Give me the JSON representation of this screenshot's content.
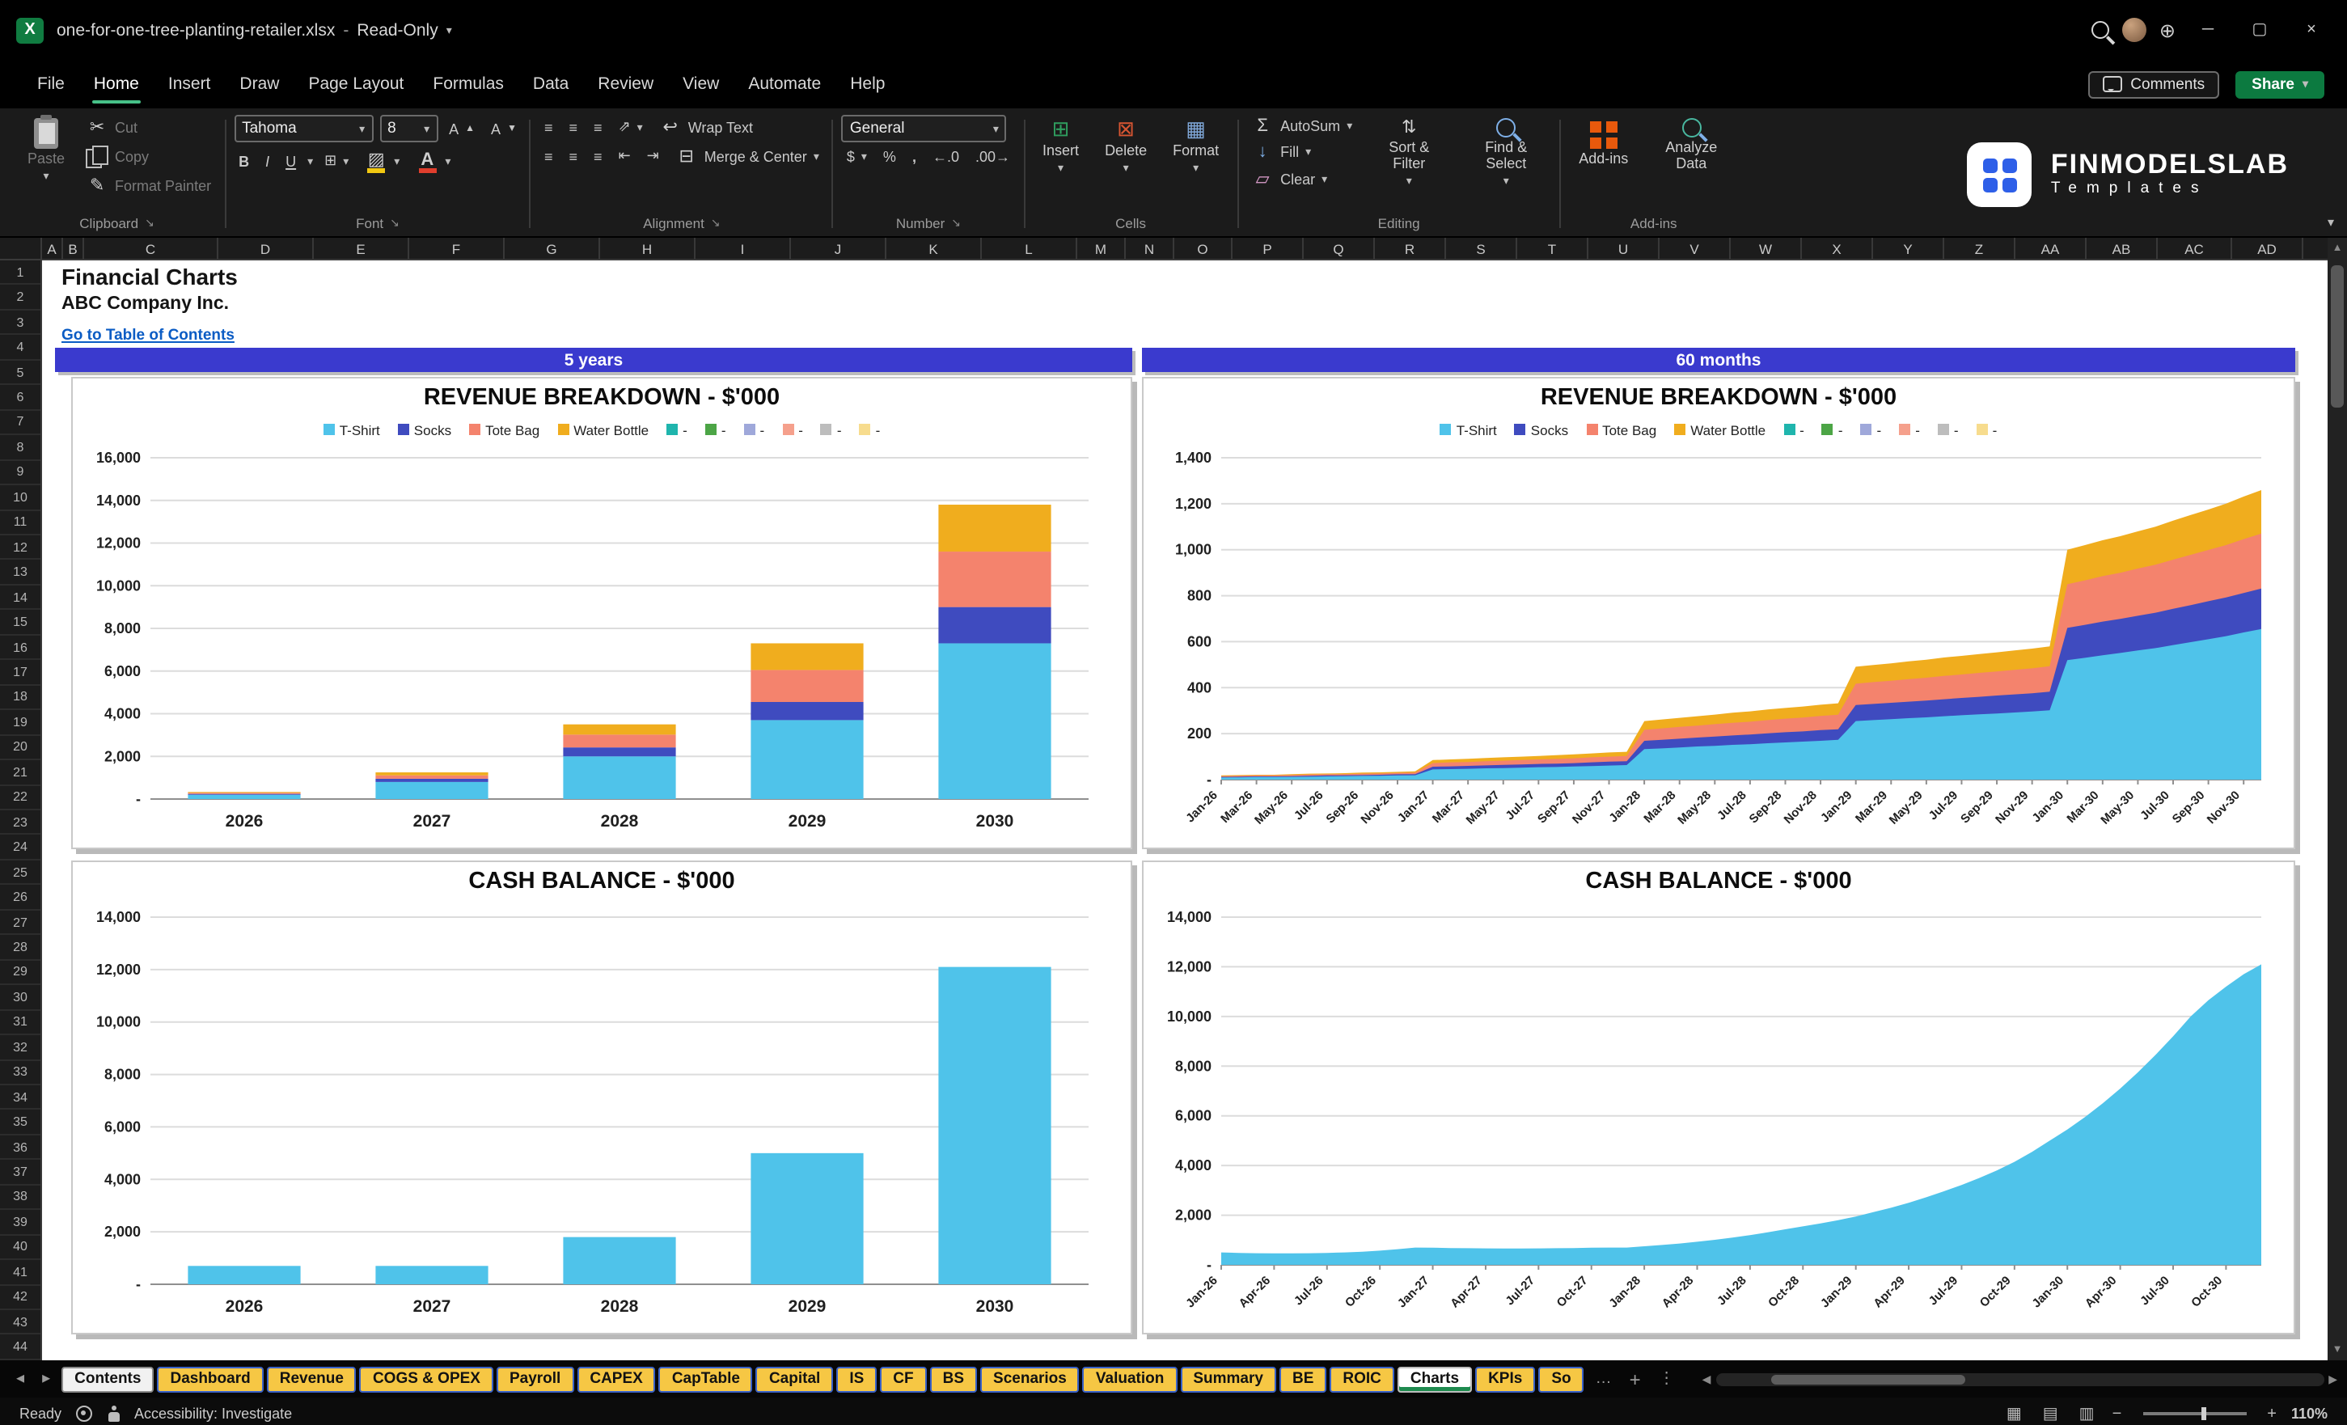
{
  "titlebar": {
    "filename": "one-for-one-tree-planting-retailer.xlsx",
    "separator": "-",
    "mode": "Read-Only"
  },
  "menubar": {
    "items": [
      "File",
      "Home",
      "Insert",
      "Draw",
      "Page Layout",
      "Formulas",
      "Data",
      "Review",
      "View",
      "Automate",
      "Help"
    ],
    "active": "Home",
    "comments": "Comments",
    "share": "Share"
  },
  "ribbon": {
    "clipboard": {
      "label": "Clipboard",
      "paste": "Paste",
      "cut": "Cut",
      "copy": "Copy",
      "format_painter": "Format Painter"
    },
    "font": {
      "label": "Font",
      "family": "Tahoma",
      "size": "8"
    },
    "alignment": {
      "label": "Alignment",
      "wrap": "Wrap Text",
      "merge": "Merge & Center"
    },
    "number": {
      "label": "Number",
      "format": "General"
    },
    "cells": {
      "label": "Cells",
      "insert": "Insert",
      "delete": "Delete",
      "format": "Format"
    },
    "editing": {
      "label": "Editing",
      "autosum": "AutoSum",
      "fill": "Fill",
      "clear": "Clear",
      "sort": "Sort & Filter",
      "find": "Find & Select"
    },
    "addins": {
      "label": "Add-ins",
      "addins": "Add-ins",
      "analyze": "Analyze Data"
    },
    "brand": {
      "name": "FINMODELSLAB",
      "sub": "Templates"
    }
  },
  "sheet": {
    "columns": [
      "A",
      "B",
      "C",
      "D",
      "E",
      "F",
      "G",
      "H",
      "I",
      "J",
      "K",
      "L",
      "M",
      "N",
      "O",
      "P",
      "Q",
      "R",
      "S",
      "T",
      "U",
      "V",
      "W",
      "X",
      "Y",
      "Z",
      "AA",
      "AB",
      "AC",
      "AD"
    ],
    "row_count": 44,
    "title": "Financial Charts",
    "company": "ABC Company Inc.",
    "link": "Go to Table of Contents",
    "banner_left": "5 years",
    "banner_right": "60 months"
  },
  "chart_data": [
    {
      "type": "stacked-bar",
      "title": "REVENUE BREAKDOWN - $'000",
      "categories": [
        "2026",
        "2027",
        "2028",
        "2029",
        "2030"
      ],
      "series": [
        {
          "name": "T-Shirt",
          "color": "#4FC3EA",
          "values": [
            200,
            800,
            2000,
            3700,
            7300
          ]
        },
        {
          "name": "Socks",
          "color": "#3F4BBF",
          "values": [
            40,
            150,
            420,
            850,
            1700
          ]
        },
        {
          "name": "Tote Bag",
          "color": "#F4836D",
          "values": [
            50,
            160,
            600,
            1500,
            2600
          ]
        },
        {
          "name": "Water Bottle",
          "color": "#F0AD1E",
          "values": [
            40,
            140,
            480,
            1250,
            2200
          ]
        }
      ],
      "legend_extra": [
        {
          "label": "-",
          "color": "#1FB5AD"
        },
        {
          "label": "-",
          "color": "#4CA546"
        },
        {
          "label": "-",
          "color": "#9FA8DA"
        },
        {
          "label": "-",
          "color": "#F5A08C"
        },
        {
          "label": "-",
          "color": "#BDBDBD"
        },
        {
          "label": "-",
          "color": "#F7DC8E"
        }
      ],
      "ymax": 16000,
      "ytick_labels": [
        "-",
        "2,000",
        "4,000",
        "6,000",
        "8,000",
        "10,000",
        "12,000",
        "14,000",
        "16,000"
      ]
    },
    {
      "type": "stacked-area",
      "title": "REVENUE BREAKDOWN - $'000",
      "x_labels": [
        "Jan-26",
        "Mar-26",
        "May-26",
        "Jul-26",
        "Sep-26",
        "Nov-26",
        "Jan-27",
        "Mar-27",
        "May-27",
        "Jul-27",
        "Sep-27",
        "Nov-27",
        "Jan-28",
        "Mar-28",
        "May-28",
        "Jul-28",
        "Sep-28",
        "Nov-28",
        "Jan-29",
        "Mar-29",
        "May-29",
        "Jul-29",
        "Sep-29",
        "Nov-29",
        "Jan-30",
        "Mar-30",
        "May-30",
        "Jul-30",
        "Sep-30",
        "Nov-30"
      ],
      "label_step": 2,
      "series": [
        {
          "name": "T-Shirt",
          "color": "#4FC3EA",
          "values": [
            9,
            10,
            11,
            11,
            12,
            13,
            14,
            15,
            16,
            17,
            18,
            19,
            44,
            46,
            47,
            49,
            50,
            52,
            54,
            55,
            57,
            59,
            61,
            63,
            133,
            136,
            140,
            144,
            147,
            151,
            154,
            158,
            162,
            165,
            169,
            173,
            255,
            259,
            263,
            267,
            271,
            276,
            280,
            284,
            288,
            292,
            296,
            302,
            520,
            530,
            541,
            551,
            562,
            572,
            585,
            598,
            611,
            624,
            640,
            655
          ]
        },
        {
          "name": "Socks",
          "color": "#3F4BBF",
          "values": [
            3,
            3,
            3,
            3,
            3,
            4,
            4,
            4,
            4,
            4,
            5,
            5,
            12,
            12,
            13,
            13,
            14,
            14,
            14,
            15,
            15,
            16,
            17,
            17,
            36,
            37,
            38,
            39,
            40,
            41,
            42,
            43,
            44,
            45,
            46,
            46,
            69,
            70,
            71,
            72,
            73,
            74,
            75,
            76,
            78,
            79,
            80,
            81,
            140,
            143,
            146,
            148,
            151,
            154,
            158,
            161,
            165,
            168,
            172,
            176
          ]
        },
        {
          "name": "Tote Bag",
          "color": "#F4836D",
          "values": [
            3,
            4,
            4,
            4,
            5,
            5,
            5,
            5,
            6,
            6,
            6,
            7,
            16,
            17,
            17,
            18,
            18,
            19,
            20,
            20,
            21,
            22,
            22,
            23,
            48,
            50,
            51,
            52,
            54,
            55,
            56,
            58,
            59,
            60,
            62,
            63,
            93,
            95,
            96,
            98,
            99,
            101,
            102,
            104,
            105,
            107,
            108,
            110,
            190,
            194,
            198,
            201,
            205,
            209,
            214,
            219,
            223,
            228,
            234,
            239
          ]
        },
        {
          "name": "Water Bottle",
          "color": "#F0AD1E",
          "values": [
            3,
            3,
            3,
            3,
            4,
            4,
            4,
            4,
            5,
            5,
            5,
            5,
            13,
            13,
            14,
            14,
            15,
            15,
            15,
            16,
            17,
            17,
            18,
            18,
            38,
            39,
            40,
            41,
            42,
            44,
            45,
            46,
            47,
            48,
            49,
            50,
            74,
            75,
            76,
            77,
            78,
            80,
            81,
            82,
            83,
            84,
            86,
            87,
            150,
            153,
            156,
            159,
            162,
            165,
            169,
            173,
            176,
            180,
            185,
            189
          ]
        }
      ],
      "legend_extra": [
        {
          "label": "-",
          "color": "#1FB5AD"
        },
        {
          "label": "-",
          "color": "#4CA546"
        },
        {
          "label": "-",
          "color": "#9FA8DA"
        },
        {
          "label": "-",
          "color": "#F5A08C"
        },
        {
          "label": "-",
          "color": "#BDBDBD"
        },
        {
          "label": "-",
          "color": "#F7DC8E"
        }
      ],
      "ymax": 1400,
      "ytick_labels": [
        "-",
        "200",
        "400",
        "600",
        "800",
        "1,000",
        "1,200",
        "1,400"
      ]
    },
    {
      "type": "bar",
      "title": "CASH BALANCE - $'000",
      "categories": [
        "2026",
        "2027",
        "2028",
        "2029",
        "2030"
      ],
      "color": "#4FC3EA",
      "values": [
        700,
        700,
        1800,
        5000,
        12100
      ],
      "ymax": 14000,
      "ytick_labels": [
        "-",
        "2,000",
        "4,000",
        "6,000",
        "8,000",
        "10,000",
        "12,000",
        "14,000"
      ]
    },
    {
      "type": "area",
      "title": "CASH BALANCE - $'000",
      "x_labels": [
        "Jan-26",
        "Apr-26",
        "Jul-26",
        "Oct-26",
        "Jan-27",
        "Apr-27",
        "Jul-27",
        "Oct-27",
        "Jan-28",
        "Apr-28",
        "Jul-28",
        "Oct-28",
        "Jan-29",
        "Apr-29",
        "Jul-29",
        "Oct-29",
        "Jan-30",
        "Apr-30",
        "Jul-30",
        "Oct-30"
      ],
      "label_step": 3,
      "color": "#4FC3EA",
      "values": [
        500,
        480,
        470,
        465,
        465,
        470,
        480,
        500,
        530,
        570,
        630,
        700,
        690,
        680,
        670,
        665,
        660,
        660,
        665,
        670,
        680,
        690,
        695,
        700,
        750,
        800,
        860,
        930,
        1010,
        1100,
        1200,
        1310,
        1430,
        1550,
        1670,
        1800,
        1950,
        2120,
        2300,
        2500,
        2720,
        2960,
        3220,
        3500,
        3800,
        4150,
        4550,
        5000,
        5450,
        5950,
        6500,
        7100,
        7750,
        8450,
        9200,
        10000,
        10650,
        11200,
        11700,
        12100
      ],
      "ymax": 14000,
      "ytick_labels": [
        "-",
        "2,000",
        "4,000",
        "6,000",
        "8,000",
        "10,000",
        "12,000",
        "14,000"
      ]
    }
  ],
  "tabs": {
    "items": [
      {
        "label": "Contents",
        "style": "white"
      },
      {
        "label": "Dashboard",
        "style": "yellow"
      },
      {
        "label": "Revenue",
        "style": "yellow"
      },
      {
        "label": "COGS & OPEX",
        "style": "yellow"
      },
      {
        "label": "Payroll",
        "style": "yellow"
      },
      {
        "label": "CAPEX",
        "style": "yellow"
      },
      {
        "label": "CapTable",
        "style": "yellow"
      },
      {
        "label": "Capital",
        "style": "yellow"
      },
      {
        "label": "IS",
        "style": "yellow"
      },
      {
        "label": "CF",
        "style": "yellow"
      },
      {
        "label": "BS",
        "style": "yellow"
      },
      {
        "label": "Scenarios",
        "style": "yellow"
      },
      {
        "label": "Valuation",
        "style": "yellow"
      },
      {
        "label": "Summary",
        "style": "yellow"
      },
      {
        "label": "BE",
        "style": "yellow"
      },
      {
        "label": "ROIC",
        "style": "yellow"
      },
      {
        "label": "Charts",
        "style": "active"
      },
      {
        "label": "KPIs",
        "style": "yellow"
      },
      {
        "label": "So",
        "style": "yellow"
      }
    ]
  },
  "statusbar": {
    "ready": "Ready",
    "accessibility": "Accessibility: Investigate",
    "zoom": "110%"
  }
}
